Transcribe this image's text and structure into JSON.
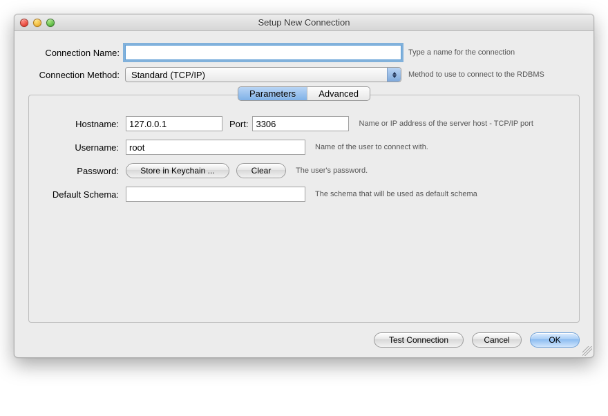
{
  "window": {
    "title": "Setup New Connection"
  },
  "top": {
    "name_label": "Connection Name:",
    "name_value": "",
    "name_hint": "Type a name for the connection",
    "method_label": "Connection Method:",
    "method_value": "Standard (TCP/IP)",
    "method_hint": "Method to use to connect to the RDBMS"
  },
  "tabs": {
    "parameters": "Parameters",
    "advanced": "Advanced"
  },
  "params": {
    "hostname_label": "Hostname:",
    "hostname_value": "127.0.0.1",
    "port_label": "Port:",
    "port_value": "3306",
    "hostport_hint": "Name or IP address of the server host - TCP/IP port",
    "username_label": "Username:",
    "username_value": "root",
    "username_hint": "Name of the user to connect with.",
    "password_label": "Password:",
    "store_btn": "Store in Keychain ...",
    "clear_btn": "Clear",
    "password_hint": "The user's password.",
    "schema_label": "Default Schema:",
    "schema_value": "",
    "schema_hint": "The schema that will be used as default schema"
  },
  "footer": {
    "test": "Test Connection",
    "cancel": "Cancel",
    "ok": "OK"
  }
}
